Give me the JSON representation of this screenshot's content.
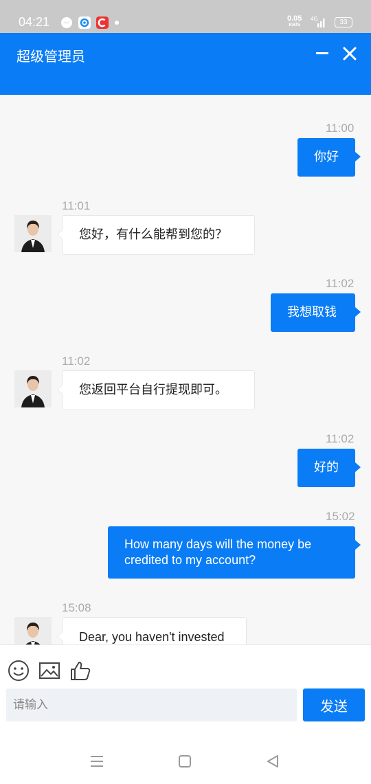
{
  "status_bar": {
    "time": "04:21",
    "net_speed": "0.05",
    "net_unit": "KB/S",
    "signal": "4G",
    "battery": "33"
  },
  "header": {
    "title": "超级管理员"
  },
  "chat": {
    "partial_top_text": "",
    "messages": [
      {
        "side": "sent",
        "time": "11:00",
        "text": "你好"
      },
      {
        "side": "recv",
        "time": "11:01",
        "text": "您好，有什么能帮到您的？"
      },
      {
        "side": "sent",
        "time": "11:02",
        "text": "我想取钱"
      },
      {
        "side": "recv",
        "time": "11:02",
        "text": "您返回平台自行提现即可。"
      },
      {
        "side": "sent",
        "time": "11:02",
        "text": "好的"
      },
      {
        "side": "sent",
        "time": "15:02",
        "text": "How many days will the money be credited to my account?"
      },
      {
        "side": "recv",
        "time": "15:08",
        "text": "Dear, you haven't invested"
      }
    ]
  },
  "composer": {
    "placeholder": "请输入",
    "send_label": "发送"
  },
  "colors": {
    "accent": "#0a7cf5",
    "background": "#f7f7f7"
  }
}
